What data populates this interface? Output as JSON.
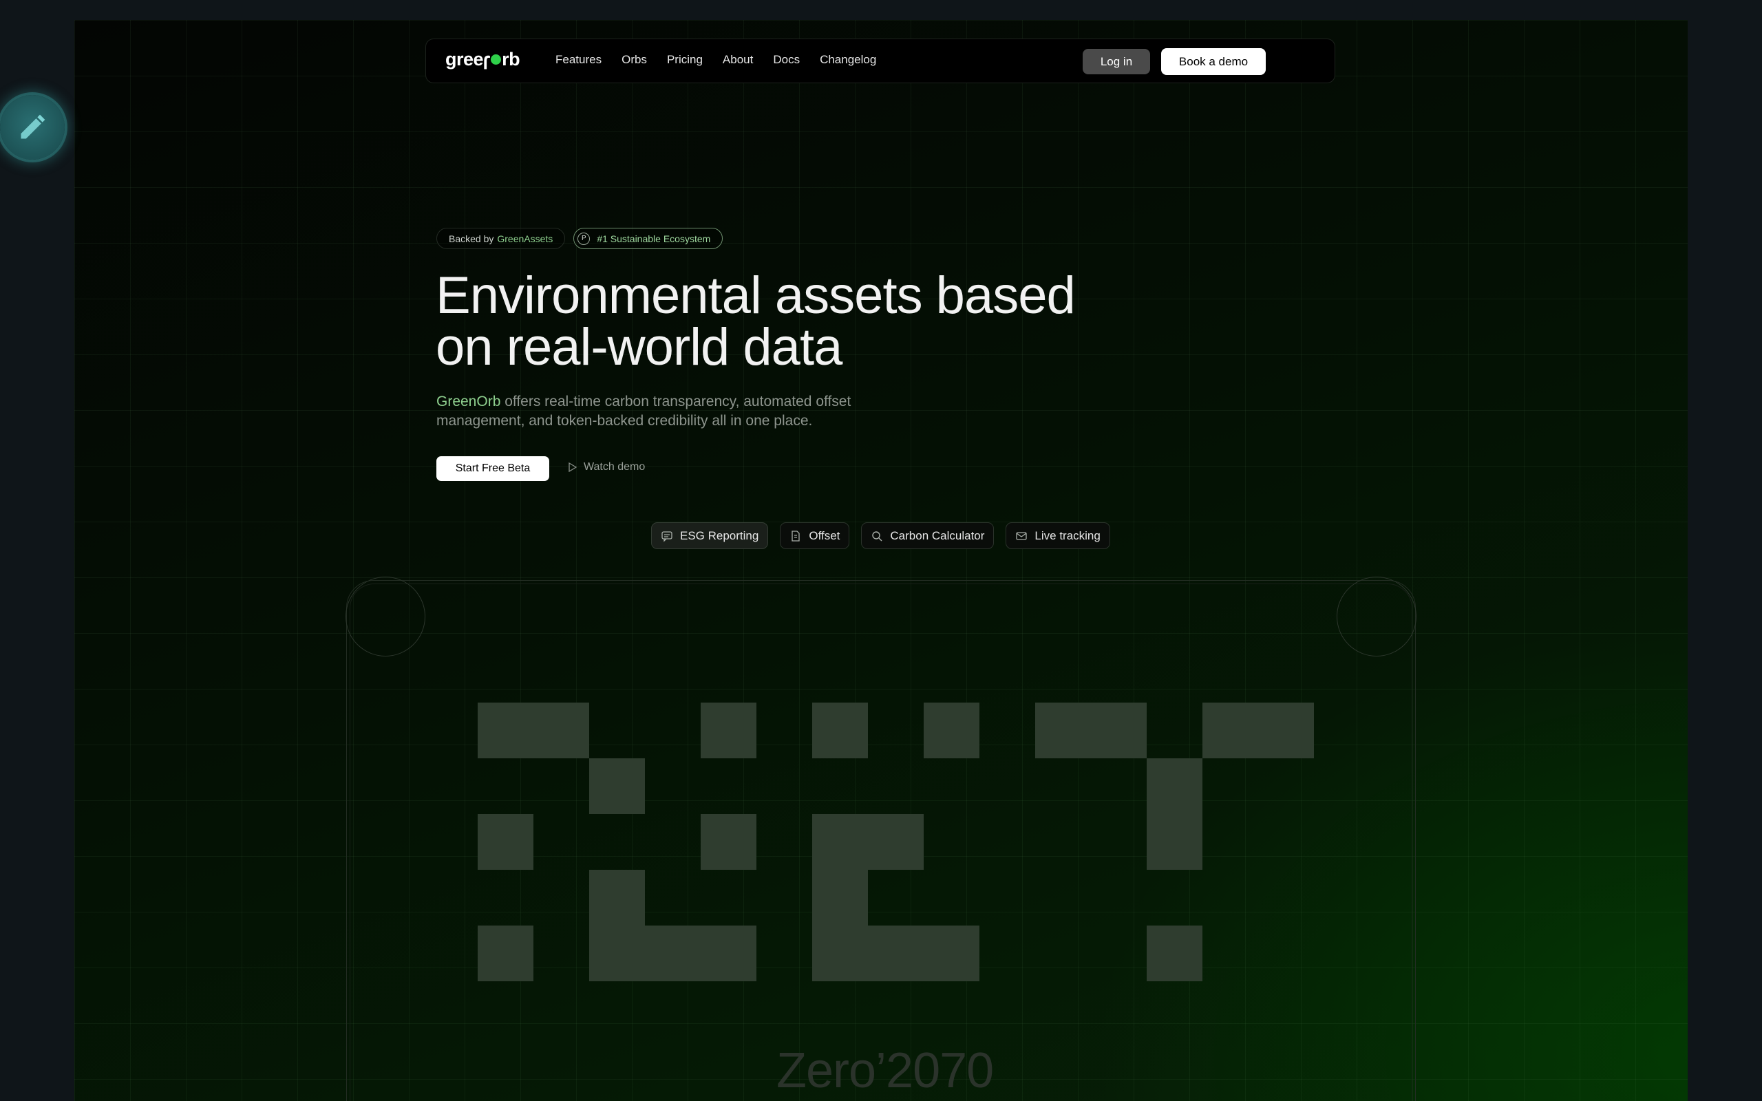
{
  "nav": {
    "logo": "greenorb",
    "links": [
      "Features",
      "Orbs",
      "Pricing",
      "About",
      "Docs",
      "Changelog"
    ],
    "login_label": "Log in",
    "demo_label": "Book a demo"
  },
  "hero": {
    "badge_backed_prefix": "Backed by",
    "badge_backed_name": "GreenAssets",
    "badge_rank_icon": "P",
    "badge_rank_label": "#1 Sustainable Ecosystem",
    "headline_line1": "Environmental assets based",
    "headline_line2": "on real-world data",
    "sub_brand": "GreenOrb",
    "sub_text": " offers real-time carbon transparency, automated offset management, and token-backed credibility all in one place.",
    "start_label": "Start Free Beta",
    "watch_label": "Watch demo"
  },
  "feature_pills": [
    {
      "label": "ESG Reporting",
      "icon": "chat-icon",
      "active": true
    },
    {
      "label": "Offset",
      "icon": "document-icon",
      "active": false
    },
    {
      "label": "Carbon Calculator",
      "icon": "search-icon",
      "active": false
    },
    {
      "label": "Live tracking",
      "icon": "mail-icon",
      "active": false
    }
  ],
  "card": {
    "footer_text": "Zero’2070"
  },
  "colors": {
    "accent_green": "#8fd08f",
    "logo_dot": "#2fd14a",
    "pixel_fill": "#2f3d2f"
  }
}
